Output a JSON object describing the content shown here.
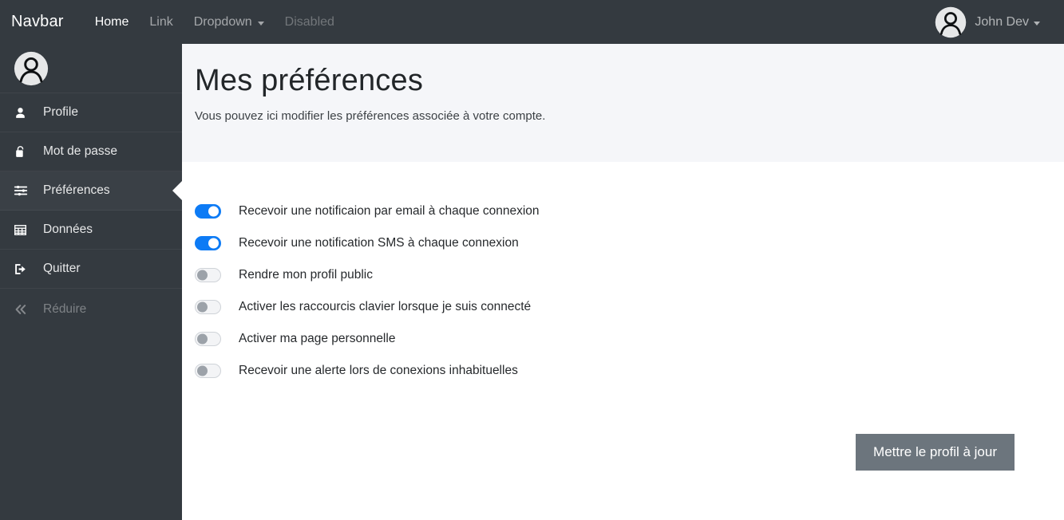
{
  "navbar": {
    "brand": "Navbar",
    "links": [
      {
        "label": "Home",
        "state": "active"
      },
      {
        "label": "Link",
        "state": "normal"
      },
      {
        "label": "Dropdown",
        "state": "dropdown"
      },
      {
        "label": "Disabled",
        "state": "disabled"
      }
    ],
    "user": {
      "name": "John Dev",
      "avatar_icon": "user-avatar-icon",
      "caret_icon": "chevron-down-icon"
    }
  },
  "sidebar": {
    "avatar_icon": "user-avatar-icon",
    "items": [
      {
        "label": "Profile",
        "icon": "user-icon",
        "active": false,
        "muted": false
      },
      {
        "label": "Mot de passe",
        "icon": "unlock-padlock-icon",
        "active": false,
        "muted": false
      },
      {
        "label": "Préférences",
        "icon": "sliders-icon",
        "active": true,
        "muted": false
      },
      {
        "label": "Données",
        "icon": "table-grid-icon",
        "active": false,
        "muted": false
      },
      {
        "label": "Quitter",
        "icon": "sign-out-icon",
        "active": false,
        "muted": false
      },
      {
        "label": "Réduire",
        "icon": "double-chevron-left-icon",
        "active": false,
        "muted": true
      }
    ]
  },
  "page": {
    "title": "Mes préférences",
    "subtitle": "Vous pouvez ici modifier les préférences associée à votre compte."
  },
  "preferences": [
    {
      "label": "Recevoir une notificaion par email à chaque connexion",
      "on": true
    },
    {
      "label": "Recevoir une notification SMS à chaque connexion",
      "on": true
    },
    {
      "label": "Rendre mon profil public",
      "on": false
    },
    {
      "label": "Activer les raccourcis clavier lorsque je suis connecté",
      "on": false
    },
    {
      "label": "Activer ma page personnelle",
      "on": false
    },
    {
      "label": "Recevoir une alerte lors de conexions inhabituelles",
      "on": false
    }
  ],
  "actions": {
    "update_profile_label": "Mettre le profil à jour"
  },
  "colors": {
    "navbar_bg": "#343a40",
    "sidebar_bg": "#343a40",
    "page_head_bg": "#f5f6f9",
    "switch_on": "#0d7bf5",
    "button_bg": "#6c757d"
  }
}
